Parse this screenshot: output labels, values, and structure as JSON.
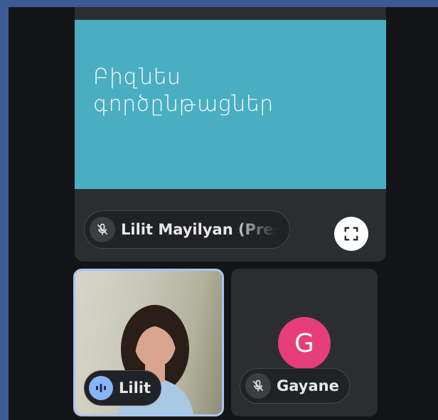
{
  "presentation": {
    "slide_title": "Բիզնես\nգործընթացներ",
    "presenter_label": "Lilit Mayilyan (Presenting)",
    "presenter_mic": "mic-off-icon",
    "fullscreen_icon": "fullscreen-icon",
    "slide_color": "#4aaec3"
  },
  "participants": [
    {
      "name": "Lilit",
      "status": "speaking",
      "status_icon": "audio-level-icon",
      "border_color": "#a9c3f5"
    },
    {
      "name": "Gayane",
      "avatar_letter": "G",
      "avatar_color": "#e63e78",
      "status": "muted",
      "status_icon": "mic-off-icon"
    }
  ]
}
